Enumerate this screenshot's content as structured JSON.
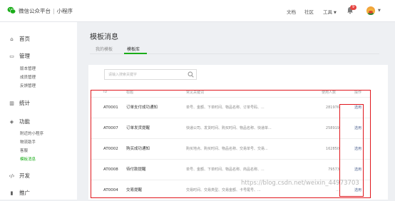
{
  "header": {
    "brand": "微信公众平台",
    "separator": "|",
    "product": "小程序",
    "nav": {
      "docs": "文档",
      "community": "社区",
      "tools": "工具"
    },
    "notification_count": "9"
  },
  "sidebar": {
    "home": "首页",
    "manage": "管理",
    "manage_items": [
      "版本管理",
      "成员管理",
      "反馈管理"
    ],
    "stats": "统计",
    "features": "功能",
    "feature_items": [
      "附近的小程序",
      "物流助手",
      "客服",
      "模板消息"
    ],
    "dev": "开发",
    "promo": "推广"
  },
  "main": {
    "title": "模板消息",
    "tabs": [
      "我的模板",
      "模板库"
    ],
    "active_tab": "模板库",
    "search_placeholder": "请输入搜索关键字",
    "columns": {
      "id": "ID",
      "title": "标题",
      "keywords": "常见关键词",
      "count": "使用人数",
      "op": "操作"
    },
    "rows": [
      {
        "id": "AT0001",
        "title": "订单支付成功通知",
        "keywords": "单号、金额、下单时间、物品名称、订单号码、...",
        "count": "281976",
        "op": "选用"
      },
      {
        "id": "AT0007",
        "title": "订单发货提醒",
        "keywords": "快递公司、发货时间、购买时间、物品名称、快递单...",
        "count": "258919",
        "op": "选用"
      },
      {
        "id": "AT0002",
        "title": "购买成功通知",
        "keywords": "购买地点、购买时间、物品名称、交易单号、交易...",
        "count": "162850",
        "op": "选用"
      },
      {
        "id": "AT0008",
        "title": "待付款提醒",
        "keywords": "单号、金额、下单时间、物品名称、商品名称、...",
        "count": "79573",
        "op": "选用"
      },
      {
        "id": "AT0004",
        "title": "交易提醒",
        "keywords": "交易时间、交易类型、交易金额、卡号尾号、...",
        "count": "...",
        "op": "选用"
      }
    ]
  },
  "watermark": "https://blog.csdn.net/weixin_44973703",
  "colors": {
    "accent": "#1aad19",
    "highlight": "#e0161c",
    "link": "#576b95",
    "badge": "#e64340"
  }
}
